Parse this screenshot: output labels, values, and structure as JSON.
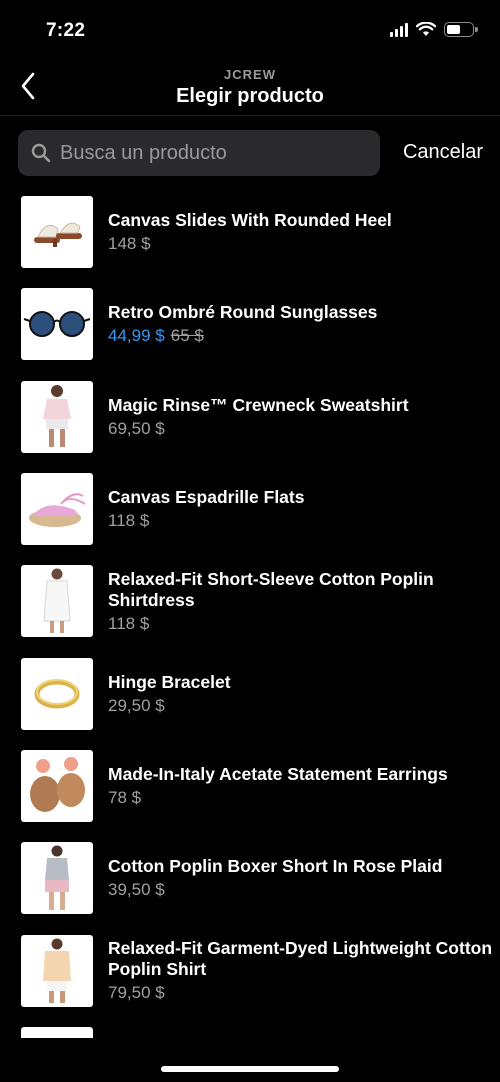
{
  "status": {
    "time": "7:22"
  },
  "nav": {
    "subtitle": "JCREW",
    "title": "Elegir producto"
  },
  "search": {
    "placeholder": "Busca un producto",
    "cancel_label": "Cancelar"
  },
  "products": [
    {
      "name": "Canvas Slides With Rounded Heel",
      "price": "148 $"
    },
    {
      "name": "Retro Ombré Round Sunglasses",
      "sale_price": "44,99 $",
      "original_price": "65 $"
    },
    {
      "name": "Magic Rinse™ Crewneck Sweatshirt",
      "price": "69,50 $"
    },
    {
      "name": "Canvas Espadrille Flats",
      "price": "118 $"
    },
    {
      "name": "Relaxed-Fit Short-Sleeve Cotton Poplin Shirtdress",
      "price": "118 $"
    },
    {
      "name": "Hinge Bracelet",
      "price": "29,50 $"
    },
    {
      "name": "Made-In-Italy Acetate Statement Earrings",
      "price": "78 $"
    },
    {
      "name": "Cotton Poplin Boxer Short In Rose Plaid",
      "price": "39,50 $"
    },
    {
      "name": "Relaxed-Fit Garment-Dyed Lightweight Cotton Poplin Shirt",
      "price": "79,50 $"
    }
  ],
  "colors": {
    "background": "#000000",
    "accent_sale": "#3897f0",
    "search_bg": "#2a2a2c",
    "secondary_text": "#a0a0a0"
  }
}
